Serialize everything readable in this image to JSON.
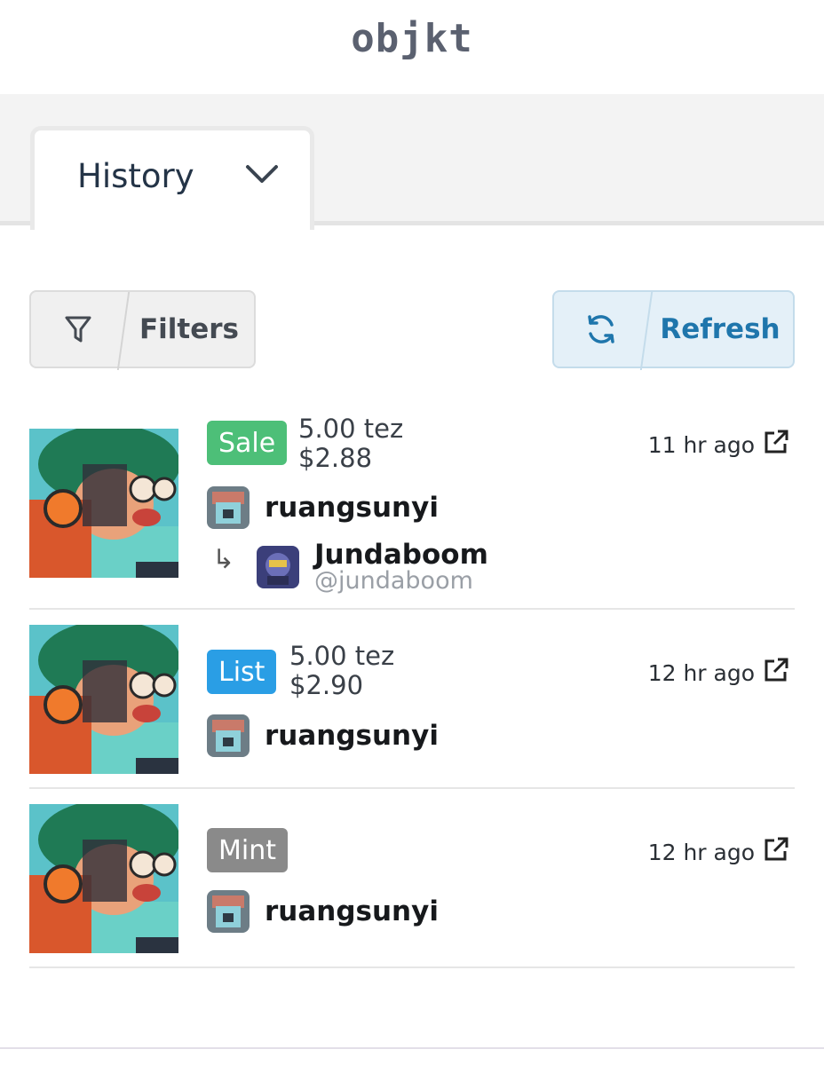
{
  "header": {
    "brand": "objkt"
  },
  "tabs": {
    "active_label": "History"
  },
  "toolbar": {
    "filters_label": "Filters",
    "refresh_label": "Refresh"
  },
  "colors": {
    "sale": "#4dbf78",
    "list": "#2a9ee5",
    "mint": "#8a8a8a",
    "refresh_text": "#1f76ac"
  },
  "events": [
    {
      "type": "Sale",
      "price_tez": "5.00 tez",
      "price_usd": "$2.88",
      "time": "11 hr ago",
      "from": "ruangsunyi",
      "to_name": "Jundaboom",
      "to_handle": "@jundaboom"
    },
    {
      "type": "List",
      "price_tez": "5.00 tez",
      "price_usd": "$2.90",
      "time": "12 hr ago",
      "from": "ruangsunyi"
    },
    {
      "type": "Mint",
      "time": "12 hr ago",
      "from": "ruangsunyi"
    }
  ],
  "icons": [
    "chevron-down-icon",
    "filter-icon",
    "refresh-icon",
    "external-link-icon",
    "reply-arrow-icon"
  ]
}
